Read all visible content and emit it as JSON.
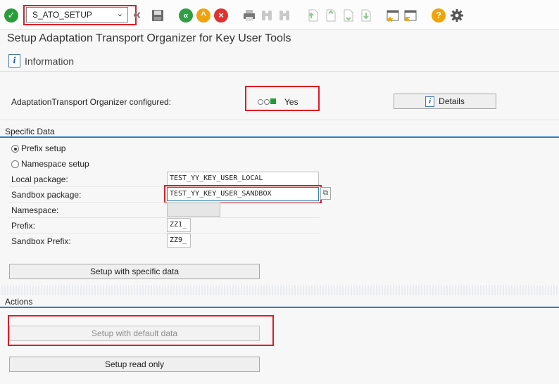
{
  "toolbar": {
    "command_value": "S_ATO_SETUP",
    "icons": [
      "enter-icon",
      "dropdown-icon",
      "previous-icon",
      "save-icon",
      "back-icon",
      "exit-icon",
      "cancel-icon",
      "print-icon",
      "find-icon",
      "find-next-icon",
      "first-page-icon",
      "previous-page-icon",
      "next-page-icon",
      "last-page-icon",
      "create-session-icon",
      "shortcut-icon",
      "help-icon",
      "settings-icon"
    ],
    "dropdown_glyph": "⌄",
    "back_glyph": "«",
    "exit_glyph": "^",
    "cancel_glyph": "×",
    "help_glyph": "?",
    "enter_glyph": "✓"
  },
  "page": {
    "title": "Setup Adaptation Transport Organizer for Key User Tools"
  },
  "appbar": {
    "info_label": "Information",
    "info_glyph": "i"
  },
  "status": {
    "label": "AdaptationTransport Organizer configured:",
    "value": "Yes",
    "details_label": "Details"
  },
  "specific": {
    "header": "Specific Data",
    "radio_prefix": "Prefix setup",
    "radio_namespace": "Namespace setup",
    "selected": "prefix",
    "local_package_label": "Local package:",
    "local_package_value": "TEST_YY_KEY_USER_LOCAL",
    "sandbox_package_label": "Sandbox package:",
    "sandbox_package_value": "TEST_YY_KEY_USER_SANDBOX",
    "namespace_label": "Namespace:",
    "namespace_value": "",
    "prefix_label": "Prefix:",
    "prefix_value": "ZZ1_",
    "sandbox_prefix_label": "Sandbox Prefix:",
    "sandbox_prefix_value": "ZZ9_",
    "setup_specific_label": "Setup with specific data"
  },
  "actions": {
    "header": "Actions",
    "setup_default_label": "Setup with default data",
    "setup_readonly_label": "Setup read only"
  },
  "colors": {
    "accent": "#2f7fc1",
    "highlight": "#e01b24",
    "status_green": "#1f9d32",
    "enter_green": "#2a9d3b",
    "back_green": "#2f9e44",
    "exit_orange": "#f0a30a",
    "cancel_red": "#e03131",
    "help_orange": "#f0a30a"
  }
}
